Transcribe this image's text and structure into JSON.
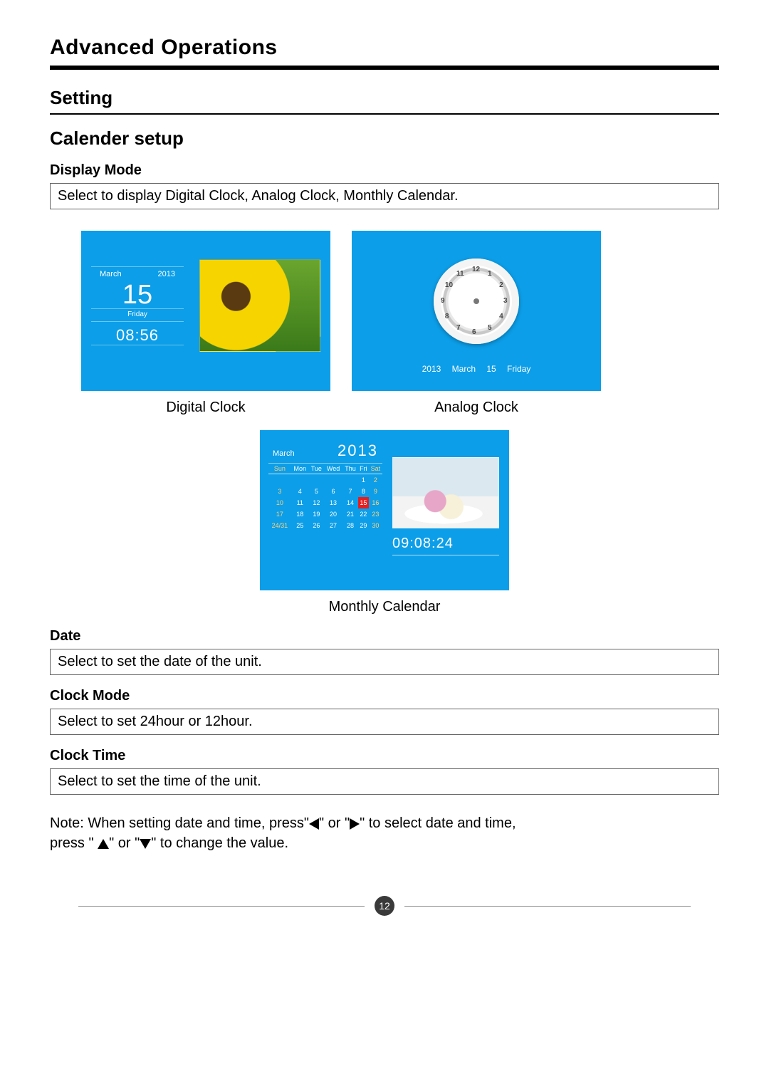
{
  "header": "Advanced Operations",
  "setting": "Setting",
  "calendar_setup": "Calender setup",
  "display_mode": {
    "label": "Display Mode",
    "desc": "Select to display Digital Clock, Analog Clock, Monthly Calendar."
  },
  "digital": {
    "caption": "Digital Clock",
    "month": "March",
    "year": "2013",
    "day": "15",
    "dow": "Friday",
    "time": "08:56"
  },
  "analog": {
    "caption": "Analog Clock",
    "year": "2013",
    "month": "March",
    "day": "15",
    "dow": "Friday",
    "numbers": [
      "12",
      "1",
      "2",
      "3",
      "4",
      "5",
      "6",
      "7",
      "8",
      "9",
      "10",
      "11"
    ]
  },
  "monthly": {
    "caption": "Monthly Calendar",
    "month": "March",
    "year": "2013",
    "dows": [
      "Sun",
      "Mon",
      "Tue",
      "Wed",
      "Thu",
      "Fri",
      "Sat"
    ],
    "weeks": [
      [
        "",
        "",
        "",
        "",
        "",
        "1",
        "2"
      ],
      [
        "3",
        "4",
        "5",
        "6",
        "7",
        "8",
        "9"
      ],
      [
        "10",
        "11",
        "12",
        "13",
        "14",
        "15",
        "16"
      ],
      [
        "17",
        "18",
        "19",
        "20",
        "21",
        "22",
        "23"
      ],
      [
        "24/31",
        "25",
        "26",
        "27",
        "28",
        "29",
        "30"
      ]
    ],
    "highlight": "15",
    "time": "09:08:24"
  },
  "date": {
    "label": "Date",
    "desc": "Select to set the date of the unit."
  },
  "clock_mode": {
    "label": "Clock Mode",
    "desc": "Select to set 24hour or 12hour."
  },
  "clock_time": {
    "label": "Clock Time",
    "desc": "Select to set the time of the unit."
  },
  "note": {
    "p1a": "Note: When setting date and time, press\"",
    "p1b": "\" or \"",
    "p1c": "\" to select date and time,",
    "p2a": "press \" ",
    "p2b": "\" or \"",
    "p2c": "\" to change the value."
  },
  "page": "12"
}
